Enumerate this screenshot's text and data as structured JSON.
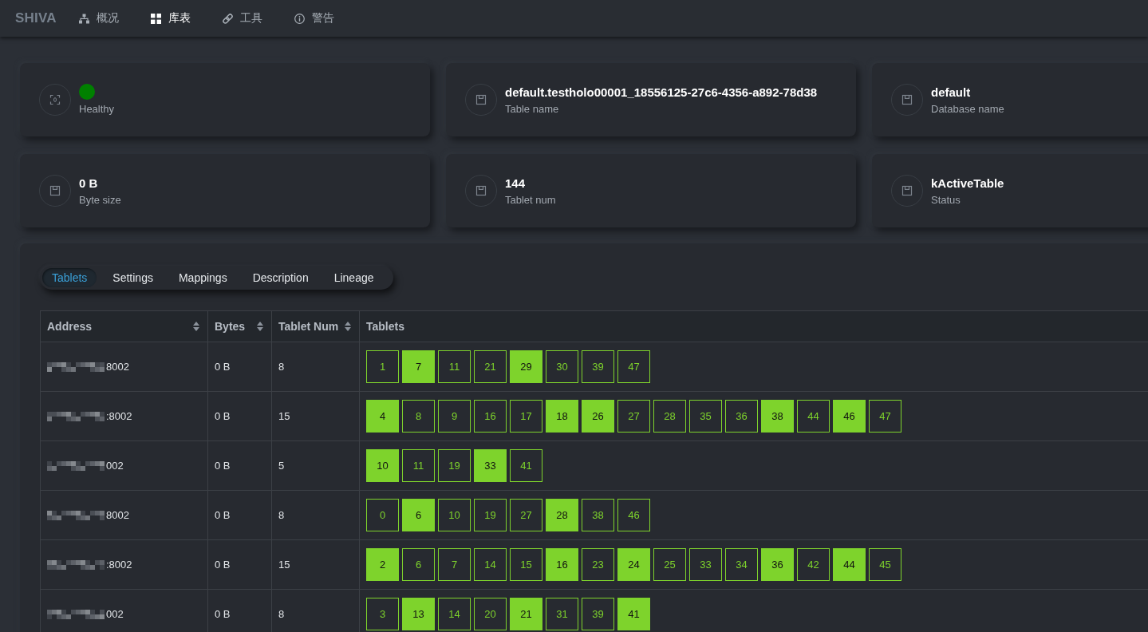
{
  "nav": {
    "brand": "SHIVA",
    "items": [
      {
        "label": "概况",
        "selected": false
      },
      {
        "label": "库表",
        "selected": true
      },
      {
        "label": "工具",
        "selected": false
      },
      {
        "label": "警告",
        "selected": false
      }
    ]
  },
  "cards": [
    {
      "kind": "status",
      "color": "#008000",
      "label": "Healthy"
    },
    {
      "kind": "info",
      "value": "default.testholo00001_18556125-27c6-4356-a892-78d38",
      "label": "Table name"
    },
    {
      "kind": "info",
      "value": "default",
      "label": "Database name"
    },
    {
      "kind": "info",
      "value": "0 B",
      "label": "Byte size"
    },
    {
      "kind": "info",
      "value": "144",
      "label": "Tablet num"
    },
    {
      "kind": "info",
      "value": "kActiveTable",
      "label": "Status"
    }
  ],
  "tabs": [
    {
      "label": "Tablets",
      "selected": true
    },
    {
      "label": "Settings",
      "selected": false
    },
    {
      "label": "Mappings",
      "selected": false
    },
    {
      "label": "Description",
      "selected": false
    },
    {
      "label": "Lineage",
      "selected": false
    }
  ],
  "table": {
    "columns": [
      {
        "label": "Address",
        "sortable": true
      },
      {
        "label": "Bytes",
        "sortable": true
      },
      {
        "label": "Tablet Num",
        "sortable": true
      },
      {
        "label": "Tablets",
        "sortable": false
      }
    ],
    "rows": [
      {
        "address": "8002",
        "bytes": "0 B",
        "tablet_num": "8",
        "tablets": [
          {
            "label": "1",
            "highlighted": false
          },
          {
            "label": "7",
            "highlighted": true
          },
          {
            "label": "11",
            "highlighted": false
          },
          {
            "label": "21",
            "highlighted": false
          },
          {
            "label": "29",
            "highlighted": true
          },
          {
            "label": "30",
            "highlighted": false
          },
          {
            "label": "39",
            "highlighted": false
          },
          {
            "label": "47",
            "highlighted": false
          }
        ]
      },
      {
        "address": ":8002",
        "bytes": "0 B",
        "tablet_num": "15",
        "tablets": [
          {
            "label": "4",
            "highlighted": true
          },
          {
            "label": "8",
            "highlighted": false
          },
          {
            "label": "9",
            "highlighted": false
          },
          {
            "label": "16",
            "highlighted": false
          },
          {
            "label": "17",
            "highlighted": false
          },
          {
            "label": "18",
            "highlighted": true
          },
          {
            "label": "26",
            "highlighted": true
          },
          {
            "label": "27",
            "highlighted": false
          },
          {
            "label": "28",
            "highlighted": false
          },
          {
            "label": "35",
            "highlighted": false
          },
          {
            "label": "36",
            "highlighted": false
          },
          {
            "label": "38",
            "highlighted": true
          },
          {
            "label": "44",
            "highlighted": false
          },
          {
            "label": "46",
            "highlighted": true
          },
          {
            "label": "47",
            "highlighted": false
          }
        ]
      },
      {
        "address": "002",
        "bytes": "0 B",
        "tablet_num": "5",
        "tablets": [
          {
            "label": "10",
            "highlighted": true
          },
          {
            "label": "11",
            "highlighted": false
          },
          {
            "label": "19",
            "highlighted": false
          },
          {
            "label": "33",
            "highlighted": true
          },
          {
            "label": "41",
            "highlighted": false
          }
        ]
      },
      {
        "address": "8002",
        "bytes": "0 B",
        "tablet_num": "8",
        "tablets": [
          {
            "label": "0",
            "highlighted": false
          },
          {
            "label": "6",
            "highlighted": true
          },
          {
            "label": "10",
            "highlighted": false
          },
          {
            "label": "19",
            "highlighted": false
          },
          {
            "label": "27",
            "highlighted": false
          },
          {
            "label": "28",
            "highlighted": true
          },
          {
            "label": "38",
            "highlighted": false
          },
          {
            "label": "46",
            "highlighted": false
          }
        ]
      },
      {
        "address": ":8002",
        "bytes": "0 B",
        "tablet_num": "15",
        "tablets": [
          {
            "label": "2",
            "highlighted": true
          },
          {
            "label": "6",
            "highlighted": false
          },
          {
            "label": "7",
            "highlighted": false
          },
          {
            "label": "14",
            "highlighted": false
          },
          {
            "label": "15",
            "highlighted": false
          },
          {
            "label": "16",
            "highlighted": true
          },
          {
            "label": "23",
            "highlighted": false
          },
          {
            "label": "24",
            "highlighted": true
          },
          {
            "label": "25",
            "highlighted": false
          },
          {
            "label": "33",
            "highlighted": false
          },
          {
            "label": "34",
            "highlighted": false
          },
          {
            "label": "36",
            "highlighted": true
          },
          {
            "label": "42",
            "highlighted": false
          },
          {
            "label": "44",
            "highlighted": true
          },
          {
            "label": "45",
            "highlighted": false
          }
        ]
      },
      {
        "address": "002",
        "bytes": "0 B",
        "tablet_num": "8",
        "tablets": [
          {
            "label": "3",
            "highlighted": false
          },
          {
            "label": "13",
            "highlighted": true
          },
          {
            "label": "14",
            "highlighted": false
          },
          {
            "label": "20",
            "highlighted": false
          },
          {
            "label": "21",
            "highlighted": true
          },
          {
            "label": "31",
            "highlighted": false
          },
          {
            "label": "39",
            "highlighted": false
          },
          {
            "label": "41",
            "highlighted": true
          }
        ]
      }
    ]
  }
}
